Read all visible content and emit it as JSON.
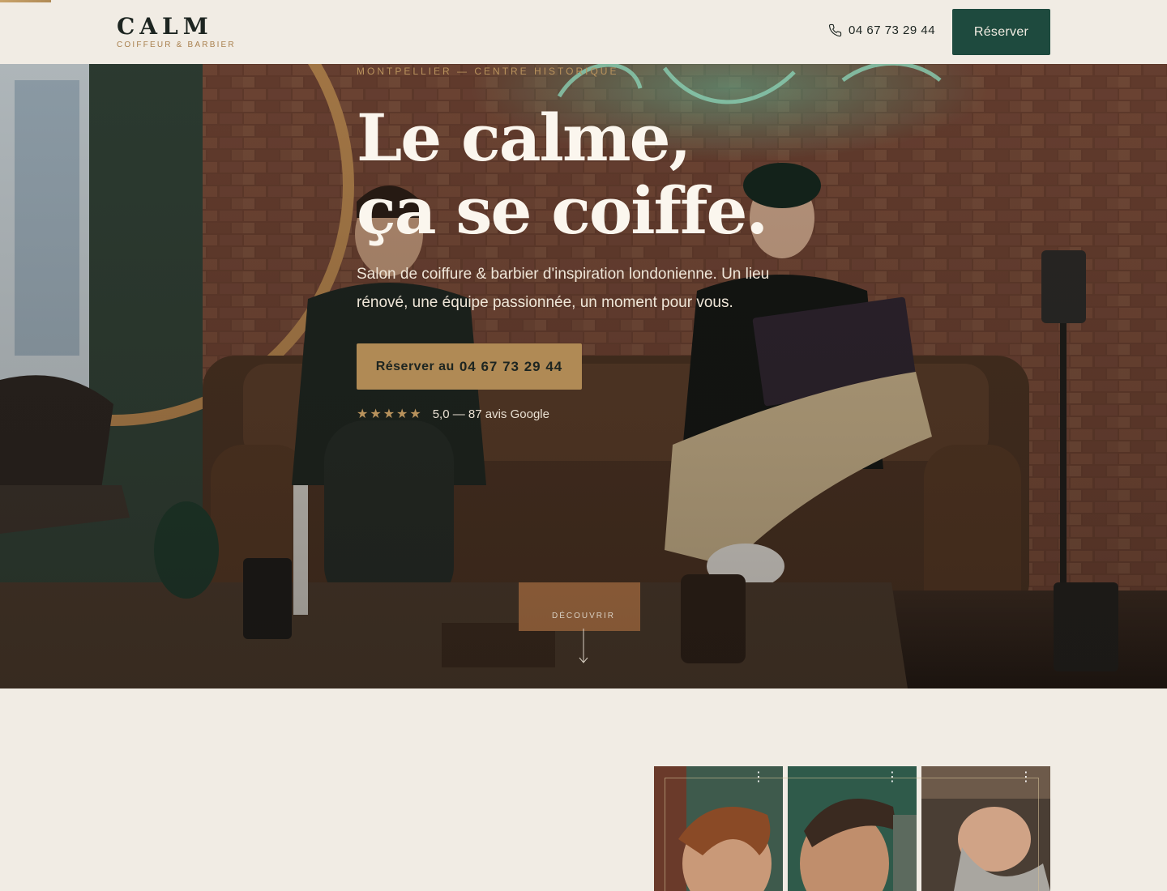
{
  "header": {
    "brand_name": "CALM",
    "brand_tagline": "COIFFEUR & BARBIER",
    "phone": "04 67 73 29 44",
    "cta_label": "Réserver"
  },
  "hero": {
    "eyebrow": "MONTPELLIER — CENTRE HISTORIQUE",
    "title_line1": "Le calme,",
    "title_line2": "ça se coiffe.",
    "subtitle": "Salon de coiffure & barbier d'inspiration londonienne. Un lieu rénové, une équipe passionnée, un moment pour vous.",
    "cta_prefix": "Réserver au",
    "cta_phone": "04 67 73 29 44",
    "stars": "★★★★★",
    "rating_text": "5,0 — 87 avis Google",
    "scroll_label": "DÉCOUVRIR"
  },
  "gallery": {
    "items": [
      "mullet-haircut",
      "fade-haircut",
      "beard-trim"
    ]
  },
  "colors": {
    "background": "#f1ece4",
    "accent_gold": "#b08a55",
    "brand_green": "#1e4a3e",
    "text_dark": "#1d2521"
  }
}
